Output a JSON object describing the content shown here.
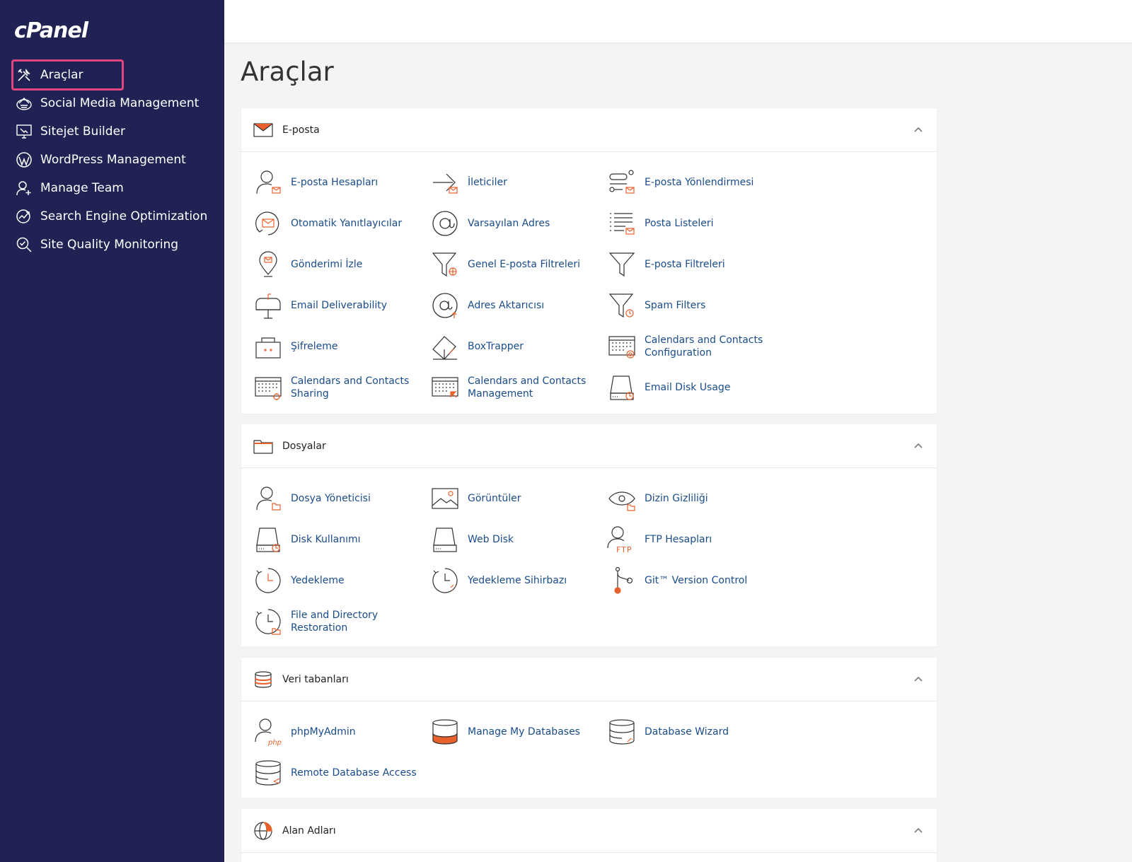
{
  "sidebar": {
    "logo": "cPanel",
    "items": [
      {
        "label": "Araçlar",
        "icon": "tools-icon"
      },
      {
        "label": "Social Media Management",
        "icon": "social-media-icon"
      },
      {
        "label": "Sitejet Builder",
        "icon": "sitejet-icon"
      },
      {
        "label": "WordPress Management",
        "icon": "wordpress-icon"
      },
      {
        "label": "Manage Team",
        "icon": "team-icon"
      },
      {
        "label": "Search Engine Optimization",
        "icon": "seo-icon"
      },
      {
        "label": "Site Quality Monitoring",
        "icon": "quality-icon"
      }
    ]
  },
  "page": {
    "title": "Araçlar"
  },
  "sections": [
    {
      "title": "E-posta",
      "icon": "envelope-icon",
      "tools": [
        {
          "label": "E-posta Hesapları",
          "icon": "email-accounts-icon"
        },
        {
          "label": "İleticiler",
          "icon": "forwarders-icon"
        },
        {
          "label": "E-posta Yönlendirmesi",
          "icon": "email-routing-icon"
        },
        {
          "label": "Otomatik Yanıtlayıcılar",
          "icon": "autoresponders-icon"
        },
        {
          "label": "Varsayılan Adres",
          "icon": "default-address-icon"
        },
        {
          "label": "Posta Listeleri",
          "icon": "mailing-lists-icon"
        },
        {
          "label": "Gönderimi İzle",
          "icon": "track-delivery-icon"
        },
        {
          "label": "Genel E-posta Filtreleri",
          "icon": "global-filters-icon"
        },
        {
          "label": "E-posta Filtreleri",
          "icon": "email-filters-icon"
        },
        {
          "label": "Email Deliverability",
          "icon": "deliverability-icon"
        },
        {
          "label": "Adres Aktarıcısı",
          "icon": "address-importer-icon"
        },
        {
          "label": "Spam Filters",
          "icon": "spam-filters-icon"
        },
        {
          "label": "Şifreleme",
          "icon": "encryption-icon"
        },
        {
          "label": "BoxTrapper",
          "icon": "boxtrapper-icon"
        },
        {
          "label": "Calendars and Contacts Configuration",
          "icon": "calendar-config-icon"
        },
        {
          "label": "Calendars and Contacts Sharing",
          "icon": "calendar-sharing-icon"
        },
        {
          "label": "Calendars and Contacts Management",
          "icon": "calendar-management-icon"
        },
        {
          "label": "Email Disk Usage",
          "icon": "email-disk-usage-icon"
        }
      ]
    },
    {
      "title": "Dosyalar",
      "icon": "folder-icon",
      "tools": [
        {
          "label": "Dosya Yöneticisi",
          "icon": "file-manager-icon"
        },
        {
          "label": "Görüntüler",
          "icon": "images-icon"
        },
        {
          "label": "Dizin Gizliliği",
          "icon": "directory-privacy-icon"
        },
        {
          "label": "Disk Kullanımı",
          "icon": "disk-usage-icon"
        },
        {
          "label": "Web Disk",
          "icon": "web-disk-icon"
        },
        {
          "label": "FTP Hesapları",
          "icon": "ftp-accounts-icon"
        },
        {
          "label": "Yedekleme",
          "icon": "backup-icon"
        },
        {
          "label": "Yedekleme Sihirbazı",
          "icon": "backup-wizard-icon"
        },
        {
          "label": "Git™ Version Control",
          "icon": "git-icon"
        },
        {
          "label": "File and Directory Restoration",
          "icon": "restoration-icon"
        }
      ]
    },
    {
      "title": "Veri tabanları",
      "icon": "database-icon",
      "tools": [
        {
          "label": "phpMyAdmin",
          "icon": "phpmyadmin-icon"
        },
        {
          "label": "Manage My Databases",
          "icon": "manage-databases-icon"
        },
        {
          "label": "Database Wizard",
          "icon": "database-wizard-icon"
        },
        {
          "label": "Remote Database Access",
          "icon": "remote-database-icon"
        }
      ]
    },
    {
      "title": "Alan Adları",
      "icon": "globe-icon",
      "tools": []
    }
  ],
  "colors": {
    "sidebar": "#1f2252",
    "accent": "#e8612c",
    "link": "#1a4c8b",
    "highlight": "#e0457b"
  }
}
